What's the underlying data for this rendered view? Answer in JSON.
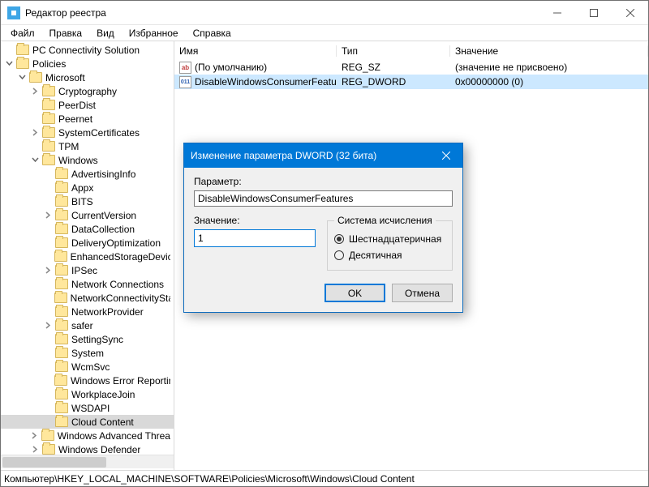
{
  "window": {
    "title": "Редактор реестра"
  },
  "menu": {
    "file": "Файл",
    "edit": "Правка",
    "view": "Вид",
    "favorites": "Избранное",
    "help": "Справка"
  },
  "tree": {
    "items": [
      {
        "depth": 0,
        "expander": "",
        "label": "PC Connectivity Solution"
      },
      {
        "depth": 0,
        "expander": "open",
        "label": "Policies"
      },
      {
        "depth": 1,
        "expander": "open",
        "label": "Microsoft"
      },
      {
        "depth": 2,
        "expander": "closed",
        "label": "Cryptography"
      },
      {
        "depth": 2,
        "expander": "",
        "label": "PeerDist"
      },
      {
        "depth": 2,
        "expander": "",
        "label": "Peernet"
      },
      {
        "depth": 2,
        "expander": "closed",
        "label": "SystemCertificates"
      },
      {
        "depth": 2,
        "expander": "",
        "label": "TPM"
      },
      {
        "depth": 2,
        "expander": "open",
        "label": "Windows"
      },
      {
        "depth": 3,
        "expander": "",
        "label": "AdvertisingInfo"
      },
      {
        "depth": 3,
        "expander": "",
        "label": "Appx"
      },
      {
        "depth": 3,
        "expander": "",
        "label": "BITS"
      },
      {
        "depth": 3,
        "expander": "closed",
        "label": "CurrentVersion"
      },
      {
        "depth": 3,
        "expander": "",
        "label": "DataCollection"
      },
      {
        "depth": 3,
        "expander": "",
        "label": "DeliveryOptimization"
      },
      {
        "depth": 3,
        "expander": "",
        "label": "EnhancedStorageDevices"
      },
      {
        "depth": 3,
        "expander": "closed",
        "label": "IPSec"
      },
      {
        "depth": 3,
        "expander": "",
        "label": "Network Connections"
      },
      {
        "depth": 3,
        "expander": "",
        "label": "NetworkConnectivityStatu"
      },
      {
        "depth": 3,
        "expander": "",
        "label": "NetworkProvider"
      },
      {
        "depth": 3,
        "expander": "closed",
        "label": "safer"
      },
      {
        "depth": 3,
        "expander": "",
        "label": "SettingSync"
      },
      {
        "depth": 3,
        "expander": "",
        "label": "System"
      },
      {
        "depth": 3,
        "expander": "",
        "label": "WcmSvc"
      },
      {
        "depth": 3,
        "expander": "",
        "label": "Windows Error Reporting"
      },
      {
        "depth": 3,
        "expander": "",
        "label": "WorkplaceJoin"
      },
      {
        "depth": 3,
        "expander": "",
        "label": "WSDAPI"
      },
      {
        "depth": 3,
        "expander": "",
        "label": "Cloud Content",
        "selected": true
      },
      {
        "depth": 2,
        "expander": "closed",
        "label": "Windows Advanced Threat P"
      },
      {
        "depth": 2,
        "expander": "closed",
        "label": "Windows Defender"
      }
    ]
  },
  "list": {
    "columns": {
      "name": "Имя",
      "type": "Тип",
      "value": "Значение"
    },
    "rows": [
      {
        "icon": "ab",
        "name": "(По умолчанию)",
        "type": "REG_SZ",
        "value": "(значение не присвоено)"
      },
      {
        "icon": "011",
        "name": "DisableWindowsConsumerFeatures",
        "type": "REG_DWORD",
        "value": "0x00000000 (0)",
        "selected": true
      }
    ]
  },
  "dialog": {
    "title": "Изменение параметра DWORD (32 бита)",
    "param_label": "Параметр:",
    "param_value": "DisableWindowsConsumerFeatures",
    "value_label": "Значение:",
    "value": "1",
    "base_legend": "Система исчисления",
    "hex": "Шестнадцатеричная",
    "dec": "Десятичная",
    "ok": "OK",
    "cancel": "Отмена"
  },
  "status": {
    "path": "Компьютер\\HKEY_LOCAL_MACHINE\\SOFTWARE\\Policies\\Microsoft\\Windows\\Cloud Content"
  }
}
